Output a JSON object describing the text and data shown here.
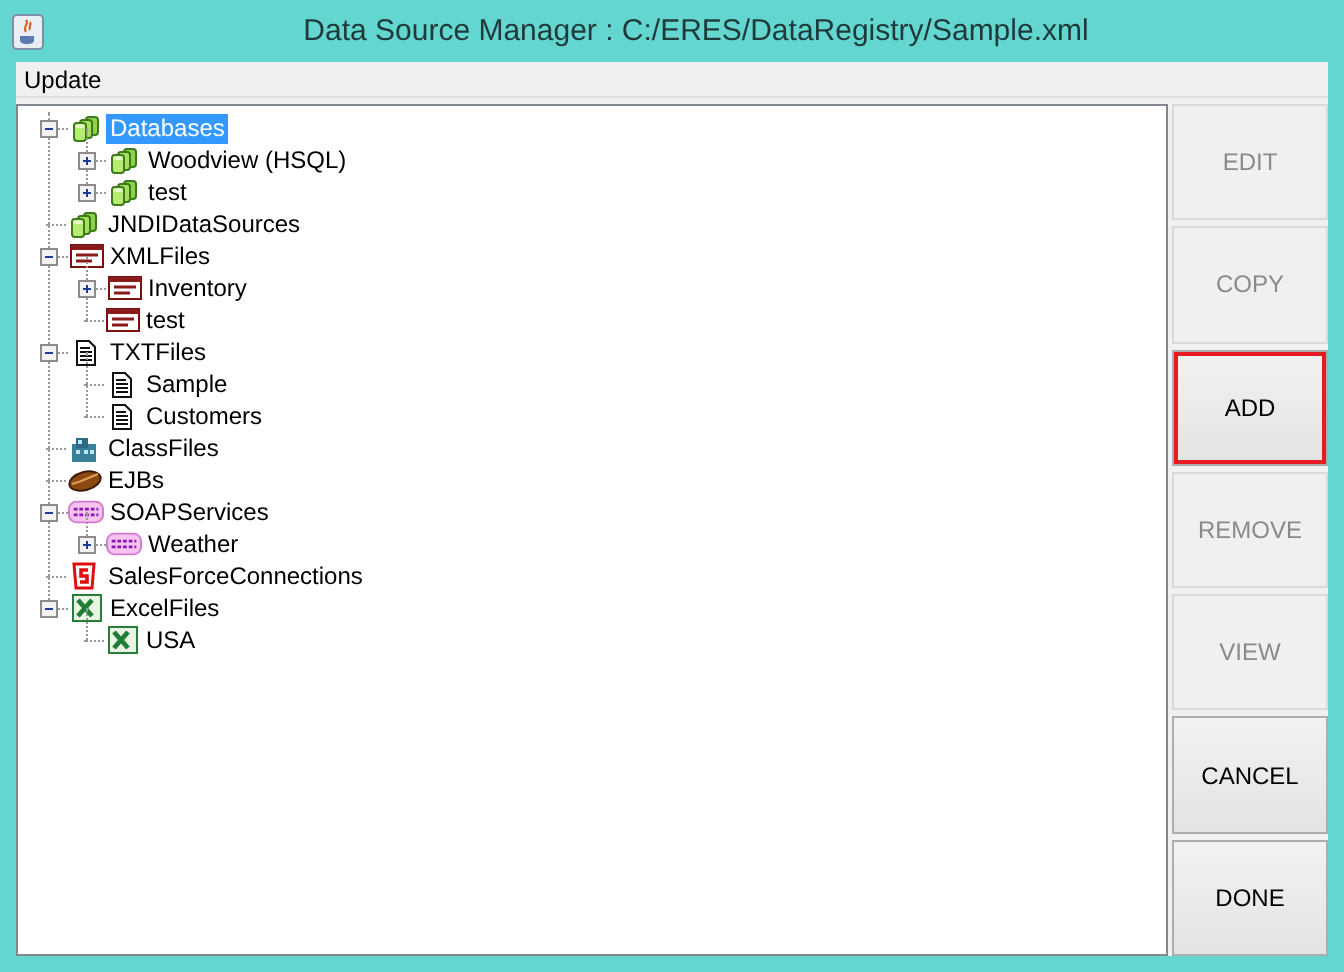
{
  "window": {
    "title": "Data Source Manager : C:/ERES/DataRegistry/Sample.xml"
  },
  "menu": [
    {
      "label": "Update"
    }
  ],
  "tree": [
    {
      "label": "Databases",
      "kind": "database",
      "expanded": true,
      "selected": true,
      "children": [
        {
          "label": "Woodview (HSQL)",
          "kind": "database",
          "expanded": false,
          "selected": false
        },
        {
          "label": "test",
          "kind": "database",
          "expanded": false,
          "selected": false
        }
      ]
    },
    {
      "label": "JNDIDataSources",
      "kind": "database",
      "selected": false
    },
    {
      "label": "XMLFiles",
      "kind": "xml",
      "expanded": true,
      "selected": false,
      "children": [
        {
          "label": "Inventory",
          "kind": "xml",
          "expanded": false,
          "selected": false
        },
        {
          "label": "test",
          "kind": "xml",
          "selected": false
        }
      ]
    },
    {
      "label": "TXTFiles",
      "kind": "text",
      "expanded": true,
      "selected": false,
      "children": [
        {
          "label": "Sample",
          "kind": "text",
          "selected": false
        },
        {
          "label": "Customers",
          "kind": "text",
          "selected": false
        }
      ]
    },
    {
      "label": "ClassFiles",
      "kind": "class",
      "selected": false
    },
    {
      "label": "EJBs",
      "kind": "bean",
      "selected": false
    },
    {
      "label": "SOAPServices",
      "kind": "soap",
      "expanded": true,
      "selected": false,
      "children": [
        {
          "label": "Weather",
          "kind": "soap",
          "expanded": false,
          "selected": false
        }
      ]
    },
    {
      "label": "SalesForceConnections",
      "kind": "salesforce",
      "selected": false
    },
    {
      "label": "ExcelFiles",
      "kind": "excel",
      "expanded": true,
      "selected": false,
      "children": [
        {
          "label": "USA",
          "kind": "excel",
          "selected": false
        }
      ]
    }
  ],
  "buttons": [
    {
      "label": "EDIT",
      "disabled": true,
      "highlighted": false
    },
    {
      "label": "COPY",
      "disabled": true,
      "highlighted": false
    },
    {
      "label": "ADD",
      "disabled": false,
      "highlighted": true
    },
    {
      "label": "REMOVE",
      "disabled": true,
      "highlighted": false
    },
    {
      "label": "VIEW",
      "disabled": true,
      "highlighted": false
    },
    {
      "label": "CANCEL",
      "disabled": false,
      "highlighted": false
    },
    {
      "label": "DONE",
      "disabled": false,
      "highlighted": false
    }
  ]
}
